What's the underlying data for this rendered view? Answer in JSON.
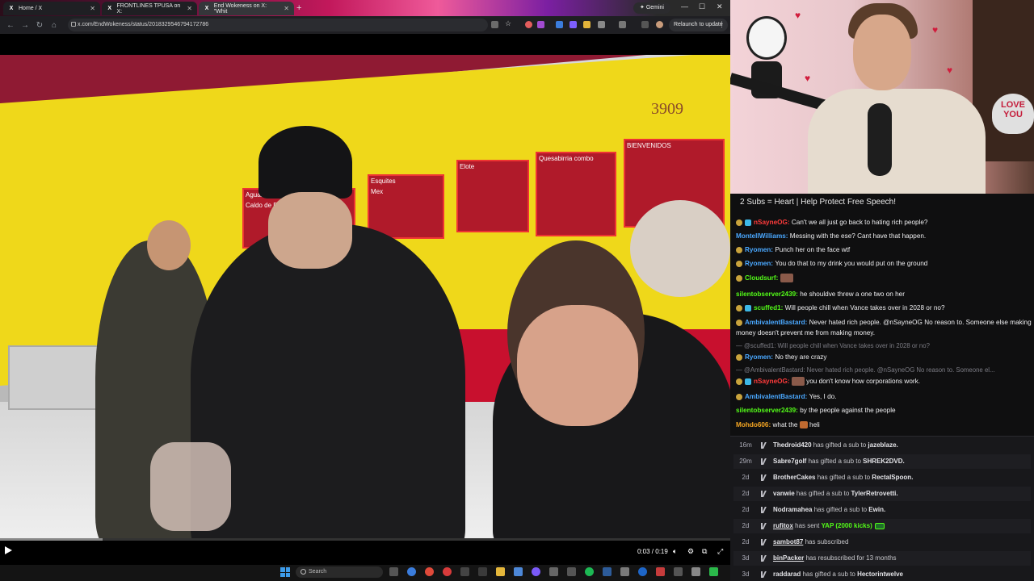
{
  "browser": {
    "tabs": [
      {
        "label": "Home / X",
        "active": false
      },
      {
        "label": "FRONTLINES TPUSA on X:",
        "active": false
      },
      {
        "label": "End Wokeness on X: \"Whit",
        "active": true
      }
    ],
    "gemini_label": "Gemini",
    "url": "x.com/EndWokeness/status/2018329546794172786",
    "relaunch_label": "Relaunch to update"
  },
  "video": {
    "storefront_number": "3909",
    "sign_texts": [
      "Aguas Frescas",
      "Esquites",
      "Elote",
      "Quesabirria combo",
      "BIENVENIDOS",
      "Caldo de Res",
      "Mex"
    ],
    "timecode": "0:03 / 0:19",
    "progress": 0.14
  },
  "taskbar": {
    "search_placeholder": "Search"
  },
  "stream": {
    "sign_text": "LOVE YOU",
    "chat_title": "2 Subs = Heart | Help Protect Free Speech!",
    "chat": [
      {
        "user": "nSayneOG",
        "color": "#ff3b3b",
        "badges": [
          "b1",
          "b2"
        ],
        "text": "Can't we all just go back to hating rich people?"
      },
      {
        "user": "MontellWilliams",
        "color": "#4aa8ff",
        "badges": [],
        "text": "Messing with the ese? Cant have that happen."
      },
      {
        "user": "Ryomen",
        "color": "#4aa8ff",
        "badges": [
          "b1"
        ],
        "text": "Punch her on the face wtf"
      },
      {
        "user": "Ryomen",
        "color": "#4aa8ff",
        "badges": [
          "b1"
        ],
        "text": "You do that to my drink you would put on the ground"
      },
      {
        "user": "Cloudsurf",
        "color": "#53fc18",
        "badges": [
          "b1"
        ],
        "text": ""
      },
      {
        "user": "silentobserver2439",
        "color": "#53fc18",
        "badges": [],
        "text": "he shouldve threw a one two on her"
      },
      {
        "user": "scuffed1",
        "color": "#53fc18",
        "badges": [
          "b1",
          "b2"
        ],
        "text": "Will people chill when Vance takes over in 2028 or no?"
      },
      {
        "user": "AmbivalentBastard",
        "color": "#4aa8ff",
        "badges": [
          "b1"
        ],
        "text": "Never hated rich people. @nSayneOG No reason to. Someone else making money doesn't prevent me from making money."
      },
      {
        "reply": "@scuffed1: Will people chill when Vance takes over in 2028 or no?"
      },
      {
        "user": "Ryomen",
        "color": "#4aa8ff",
        "badges": [
          "b1"
        ],
        "text": "No they are crazy"
      },
      {
        "reply": "@AmbivalentBastard: Never hated rich people. @nSayneOG No reason to. Someone el..."
      },
      {
        "user": "nSayneOG",
        "color": "#ff3b3b",
        "badges": [
          "b1",
          "b2"
        ],
        "text": "you don't know how corporations work."
      },
      {
        "user": "AmbivalentBastard",
        "color": "#4aa8ff",
        "badges": [
          "b1"
        ],
        "text": "Yes, I do."
      },
      {
        "user": "silentobserver2439",
        "color": "#53fc18",
        "badges": [],
        "text": "by the people against the people"
      },
      {
        "user": "Mohdo606",
        "color": "#f5a623",
        "badges": [],
        "text": "what the",
        "suffix": "heli"
      }
    ],
    "events": [
      {
        "time": "16m",
        "user": "Thedroid420",
        "underline": false,
        "text": "has gifted a sub to",
        "target": "jazeblaze."
      },
      {
        "time": "29m",
        "user": "Sabre7golf",
        "underline": false,
        "text": "has gifted a sub to",
        "target": "SHREK2DVD."
      },
      {
        "time": "2d",
        "user": "BrotherCakes",
        "underline": false,
        "text": "has gifted a sub to",
        "target": "RectalSpoon."
      },
      {
        "time": "2d",
        "user": "vanwie",
        "underline": false,
        "text": "has gifted a sub to",
        "target": "TylerRetrovetti."
      },
      {
        "time": "2d",
        "user": "Nodramahea",
        "underline": false,
        "text": "has gifted a sub to",
        "target": "Ewin."
      },
      {
        "time": "2d",
        "user": "rufitox",
        "underline": true,
        "text": "has sent",
        "target": "YAP (2000 kicks)",
        "kicks": true
      },
      {
        "time": "2d",
        "user": "sambot87",
        "underline": true,
        "text": "has subscribed",
        "target": ""
      },
      {
        "time": "3d",
        "user": "binPacker",
        "underline": true,
        "text": "has resubscribed for 13 months",
        "target": ""
      },
      {
        "time": "3d",
        "user": "raddarad",
        "underline": false,
        "text": "has gifted a sub to",
        "target": "Hectorintwelve"
      }
    ]
  }
}
